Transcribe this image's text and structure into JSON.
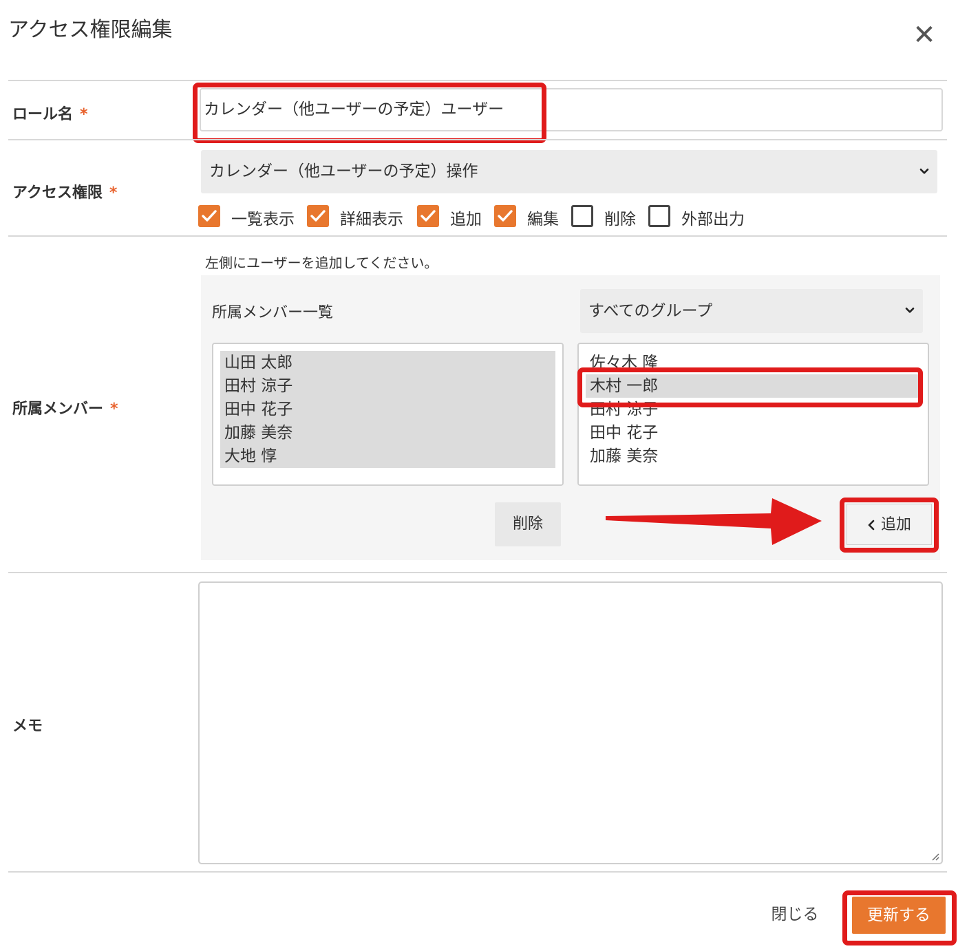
{
  "dialog": {
    "title": "アクセス権限編集"
  },
  "role_name": {
    "label": "ロール名",
    "required_mark": "*",
    "value": "カレンダー（他ユーザーの予定）ユーザー"
  },
  "access": {
    "label": "アクセス権限",
    "required_mark": "*",
    "selected": "カレンダー（他ユーザーの予定）操作",
    "permissions": [
      {
        "label": "一覧表示",
        "checked": true
      },
      {
        "label": "詳細表示",
        "checked": true
      },
      {
        "label": "追加",
        "checked": true
      },
      {
        "label": "編集",
        "checked": true
      },
      {
        "label": "削除",
        "checked": false
      },
      {
        "label": "外部出力",
        "checked": false
      }
    ]
  },
  "members": {
    "label": "所属メンバー",
    "required_mark": "*",
    "hint": "左側にユーザーを追加してください。",
    "list_title": "所属メンバー一覧",
    "group_select": "すべてのグループ",
    "assigned": [
      "山田 太郎",
      "田村 涼子",
      "田中 花子",
      "加藤 美奈",
      "大地 惇"
    ],
    "available": [
      "佐々木 隆",
      "木村 一郎",
      "田村 涼子",
      "田中 花子",
      "加藤 美奈"
    ],
    "remove_button": "削除",
    "add_button": "追加"
  },
  "memo": {
    "label": "メモ"
  },
  "footer": {
    "close_button": "閉じる",
    "update_button": "更新する"
  },
  "colors": {
    "accent": "#e8772e",
    "required": "#e8612c",
    "highlight": "#e01b1b"
  }
}
